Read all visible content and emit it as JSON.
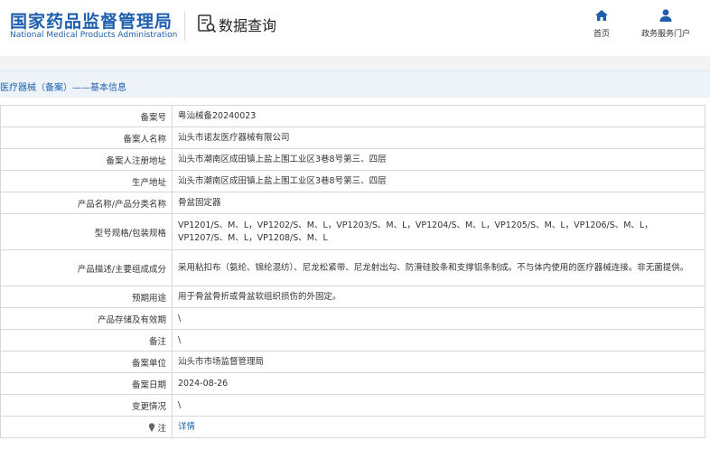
{
  "header": {
    "org_name_cn": "国家药品监督管理局",
    "org_name_en": "National Medical Products Administration",
    "query_title": "数据查询",
    "nav": [
      {
        "label": "首页",
        "icon": "home-icon"
      },
      {
        "label": "政务服务门户",
        "icon": "user-icon"
      }
    ]
  },
  "breadcrumb": "医疗器械（备案）——基本信息",
  "colors": {
    "brand": "#1d5fae",
    "band": "#edf3f9",
    "border": "#d6d6d6"
  },
  "record": {
    "rows": [
      {
        "label": "备案号",
        "value": "粤汕械备20240023"
      },
      {
        "label": "备案人名称",
        "value": "汕头市诺友医疗器械有限公司"
      },
      {
        "label": "备案人注册地址",
        "value": "汕头市潮南区成田镇上盐上围工业区3巷8号第三、四层"
      },
      {
        "label": "生产地址",
        "value": "汕头市潮南区成田镇上盐上围工业区3巷8号第三、四层"
      },
      {
        "label": "产品名称/产品分类名称",
        "value": "骨盆固定器"
      },
      {
        "label": "型号规格/包装规格",
        "value": "VP1201/S、M、L，VP1202/S、M、L，VP1203/S、M、L，VP1204/S、M、L，VP1205/S、M、L，VP1206/S、M、L，VP1207/S、M、L，VP1208/S、M、L"
      },
      {
        "label": "产品描述/主要组成成分",
        "value": "采用粘扣布（氨纶、锦纶混纺）、尼龙松紧带、尼龙射出勾、防滑硅胶条和支撑铝条制成。不与体内使用的医疗器械连接。非无菌提供。"
      },
      {
        "label": "预期用途",
        "value": "用于骨盆骨折或骨盆软组织损伤的外固定。"
      },
      {
        "label": "产品存储及有效期",
        "value": "\\"
      },
      {
        "label": "备注",
        "value": "\\"
      },
      {
        "label": "备案单位",
        "value": "汕头市市场监督管理局"
      },
      {
        "label": "备案日期",
        "value": "2024-08-26"
      },
      {
        "label": "变更情况",
        "value": "\\"
      },
      {
        "label": "注",
        "value": "详情",
        "icon": "pin-icon"
      }
    ]
  }
}
